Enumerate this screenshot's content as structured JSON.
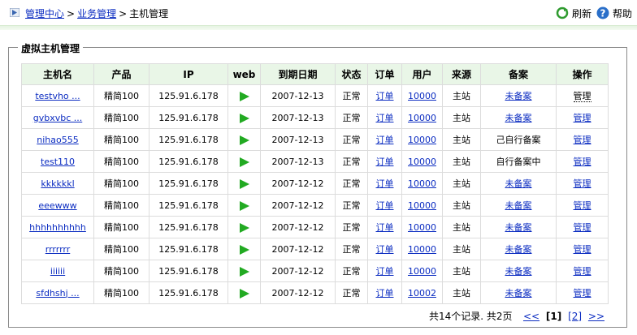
{
  "breadcrumb": {
    "items": [
      "管理中心",
      "业务管理",
      "主机管理"
    ],
    "separator": ">"
  },
  "actions": {
    "refresh": "刷新",
    "help": "帮助"
  },
  "panel": {
    "title": "虚拟主机管理"
  },
  "table": {
    "headers": [
      "主机名",
      "产品",
      "IP",
      "web",
      "到期日期",
      "状态",
      "订单",
      "用户",
      "来源",
      "备案",
      "操作"
    ],
    "rows": [
      {
        "name": "testvho ...",
        "product": "精简100",
        "ip": "125.91.6.178",
        "expire": "2007-12-13",
        "status": "正常",
        "order": "订单",
        "user": "10000",
        "source": "主站",
        "record": "未备案",
        "record_link": true,
        "op": "管理"
      },
      {
        "name": "gvbxvbc ...",
        "product": "精简100",
        "ip": "125.91.6.178",
        "expire": "2007-12-13",
        "status": "正常",
        "order": "订单",
        "user": "10000",
        "source": "主站",
        "record": "未备案",
        "record_link": true,
        "op": "管理"
      },
      {
        "name": "nihao555",
        "product": "精简100",
        "ip": "125.91.6.178",
        "expire": "2007-12-13",
        "status": "正常",
        "order": "订单",
        "user": "10000",
        "source": "主站",
        "record": "己自行备案",
        "record_link": false,
        "op": "管理"
      },
      {
        "name": "test110",
        "product": "精简100",
        "ip": "125.91.6.178",
        "expire": "2007-12-13",
        "status": "正常",
        "order": "订单",
        "user": "10000",
        "source": "主站",
        "record": "自行备案中",
        "record_link": false,
        "op": "管理"
      },
      {
        "name": "kkkkkkl",
        "product": "精简100",
        "ip": "125.91.6.178",
        "expire": "2007-12-12",
        "status": "正常",
        "order": "订单",
        "user": "10000",
        "source": "主站",
        "record": "未备案",
        "record_link": true,
        "op": "管理"
      },
      {
        "name": "eeewww",
        "product": "精简100",
        "ip": "125.91.6.178",
        "expire": "2007-12-12",
        "status": "正常",
        "order": "订单",
        "user": "10000",
        "source": "主站",
        "record": "未备案",
        "record_link": true,
        "op": "管理"
      },
      {
        "name": "hhhhhhhhhh",
        "product": "精简100",
        "ip": "125.91.6.178",
        "expire": "2007-12-12",
        "status": "正常",
        "order": "订单",
        "user": "10000",
        "source": "主站",
        "record": "未备案",
        "record_link": true,
        "op": "管理"
      },
      {
        "name": "rrrrrrr",
        "product": "精简100",
        "ip": "125.91.6.178",
        "expire": "2007-12-12",
        "status": "正常",
        "order": "订单",
        "user": "10000",
        "source": "主站",
        "record": "未备案",
        "record_link": true,
        "op": "管理"
      },
      {
        "name": "iiiiii",
        "product": "精简100",
        "ip": "125.91.6.178",
        "expire": "2007-12-12",
        "status": "正常",
        "order": "订单",
        "user": "10000",
        "source": "主站",
        "record": "未备案",
        "record_link": true,
        "op": "管理"
      },
      {
        "name": "sfdhshj ...",
        "product": "精简100",
        "ip": "125.91.6.178",
        "expire": "2007-12-12",
        "status": "正常",
        "order": "订单",
        "user": "10002",
        "source": "主站",
        "record": "未备案",
        "record_link": true,
        "op": "管理"
      }
    ]
  },
  "pager": {
    "summary": "共14个记录. 共2页",
    "prev": "<<",
    "pages": [
      "[1]",
      "[2]"
    ],
    "next": ">>"
  },
  "colors": {
    "header_bg": "#e9f6e7",
    "link": "#0b2cc1",
    "play": "#22aa22"
  }
}
